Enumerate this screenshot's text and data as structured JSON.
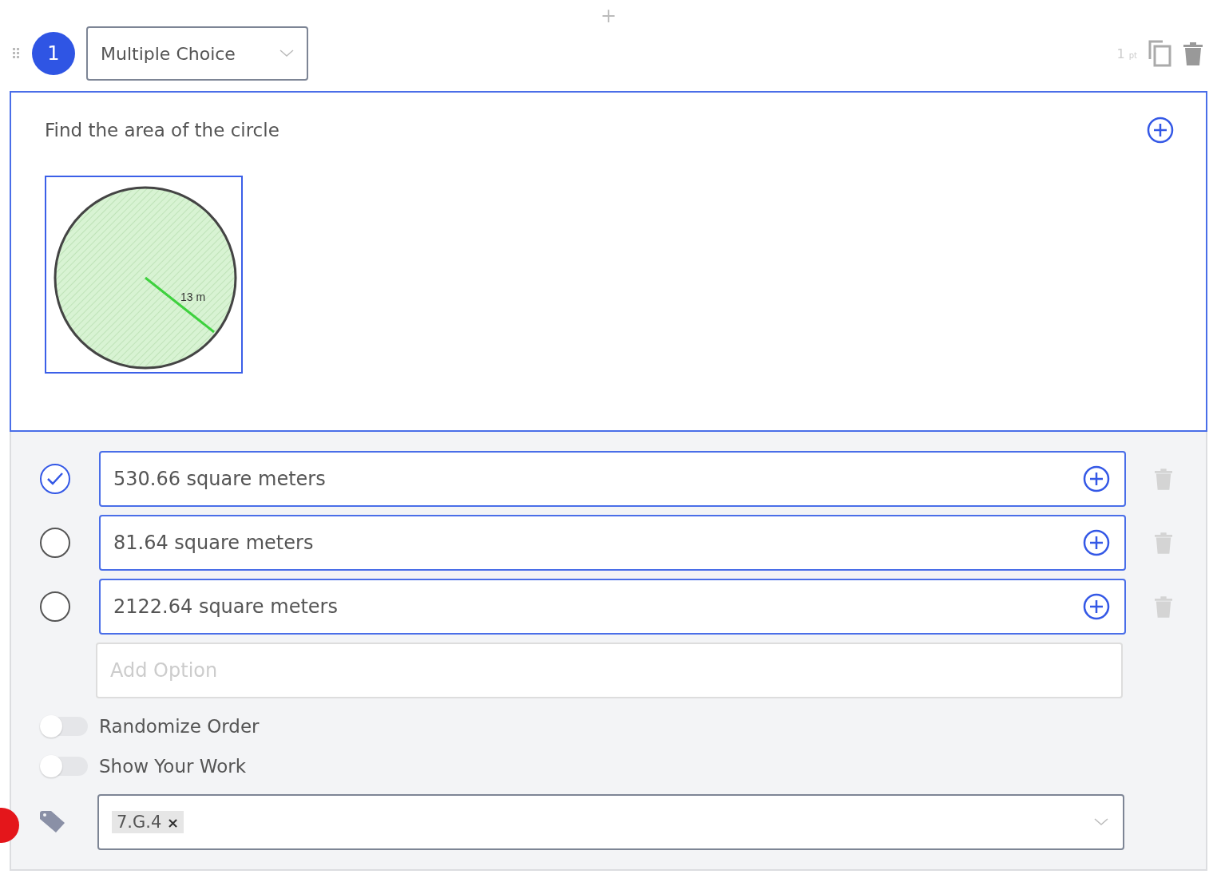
{
  "add_question_symbol": "+",
  "question": {
    "number": "1",
    "type": "Multiple Choice",
    "points_value": "1",
    "points_unit": "pt",
    "prompt": "Find the area of the circle",
    "image": {
      "radius_label": "13 m"
    }
  },
  "options": [
    {
      "text": "530.66 square meters",
      "selected": true
    },
    {
      "text": "81.64 square meters",
      "selected": false
    },
    {
      "text": "2122.64 square meters",
      "selected": false
    }
  ],
  "add_option": {
    "placeholder": "Add Option"
  },
  "settings": [
    {
      "label": "Randomize Order",
      "on": false
    },
    {
      "label": "Show Your Work",
      "on": false
    }
  ],
  "tags": [
    {
      "label": "7.G.4",
      "remove_symbol": "×"
    }
  ]
}
